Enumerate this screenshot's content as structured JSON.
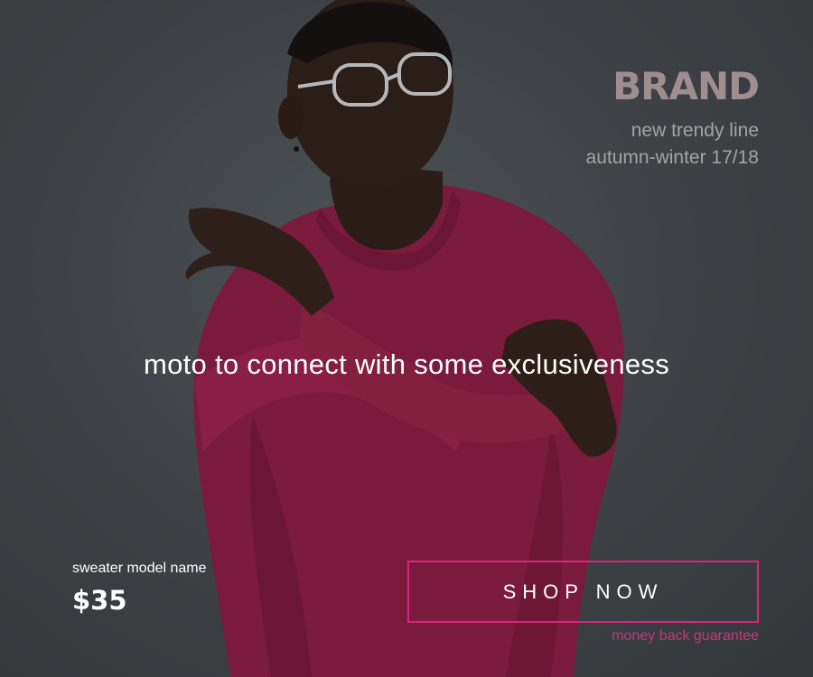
{
  "brand": {
    "name": "BRAND",
    "line1": "new trendy line",
    "line2": "autumn-winter 17/18"
  },
  "motto": "moto to connect with some exclusiveness",
  "product": {
    "name": "sweater model name",
    "price": "$35"
  },
  "cta": {
    "label": "SHOP NOW",
    "guarantee": "money back guarantee"
  },
  "colors": {
    "accent": "#e0227d",
    "guarantee": "#c23a78",
    "brand": "#9f8e8f",
    "sweater": "#7a1a3c",
    "background": "#3f4347"
  }
}
